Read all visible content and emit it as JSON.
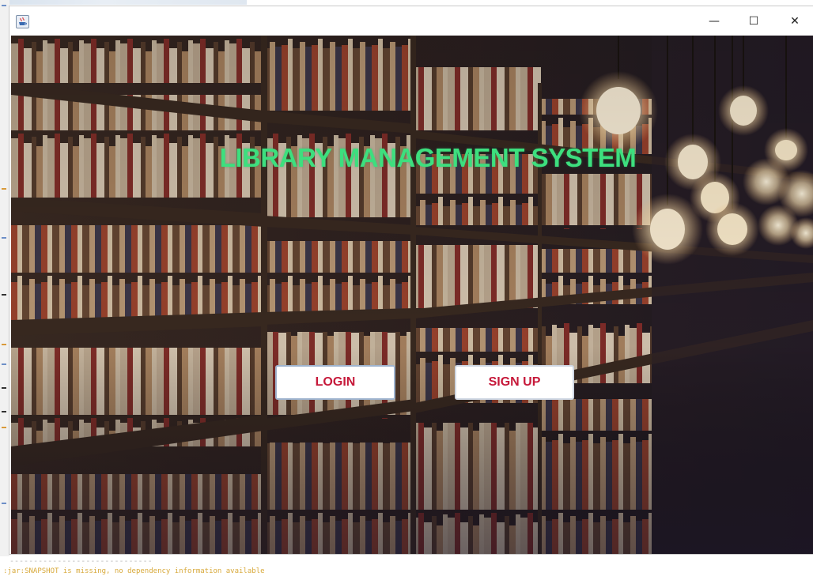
{
  "window": {
    "title": "",
    "controls": {
      "minimize_glyph": "—",
      "maximize_glyph": "☐",
      "close_glyph": "✕"
    }
  },
  "main": {
    "heading": "LIBRARY MANAGEMENT SYSTEM",
    "login_label": "LOGIN",
    "signup_label": "SIGN UP"
  },
  "console": {
    "separator": "------------------------------",
    "message": ":jar:SNAPSHOT is missing, no dependency information available"
  },
  "colors": {
    "heading": "#3ddf7e",
    "button_text": "#c6193a",
    "button_bg": "#ffffff",
    "console_text": "#d8a93a"
  },
  "icons": {
    "app": "java-app-icon",
    "minimize": "minimize-icon",
    "maximize": "maximize-icon",
    "close": "close-icon"
  }
}
